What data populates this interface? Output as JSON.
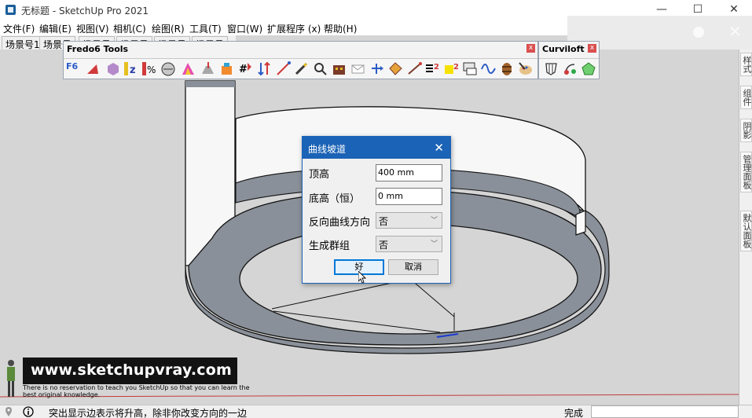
{
  "window": {
    "title": "无标题 - SketchUp Pro 2021",
    "controls": [
      "—",
      "☐",
      "✕"
    ]
  },
  "menubar": [
    "文件(F)",
    "编辑(E)",
    "视图(V)",
    "相机(C)",
    "绘图(R)",
    "工具(T)",
    "窗口(W)",
    "扩展程序 (x)",
    "帮助(H)"
  ],
  "scene_tabs": [
    "场景号1",
    "场景号",
    "场景号",
    "场景号",
    "场景号",
    "场景号"
  ],
  "toolbars": {
    "fredo6": {
      "title": "Fredo6 Tools",
      "close": "x"
    },
    "curviloft": {
      "title": "Curviloft",
      "close": "x"
    }
  },
  "dialog": {
    "title": "曲线坡道",
    "close": "✕",
    "fields": [
      {
        "label": "顶高",
        "value": "400 mm",
        "kind": "input"
      },
      {
        "label": "底高（恒）",
        "value": "0 mm",
        "kind": "input"
      },
      {
        "label": "反向曲线方向",
        "value": "否",
        "kind": "select"
      },
      {
        "label": "生成群组",
        "value": "否",
        "kind": "select"
      }
    ],
    "ok": "好",
    "cancel": "取消"
  },
  "tray_tabs": [
    "样式",
    "组件",
    "阴影",
    "管理面板",
    "默认面板"
  ],
  "watermark": {
    "url": "www.sketchupvray.com",
    "caption": "There is no reservation to teach you SketchUp so that you can learn the best original knowledge."
  },
  "status": {
    "text": "突出显示边表示将升高，除非你改变方向的一边",
    "measure_label": "完成",
    "measure_value": ""
  },
  "colors": {
    "dialog_title": "#1b63b6",
    "viewport": "#d5d5d5",
    "ramp_fill": "#8a9099",
    "wall_fill": "#f6f6f6"
  }
}
